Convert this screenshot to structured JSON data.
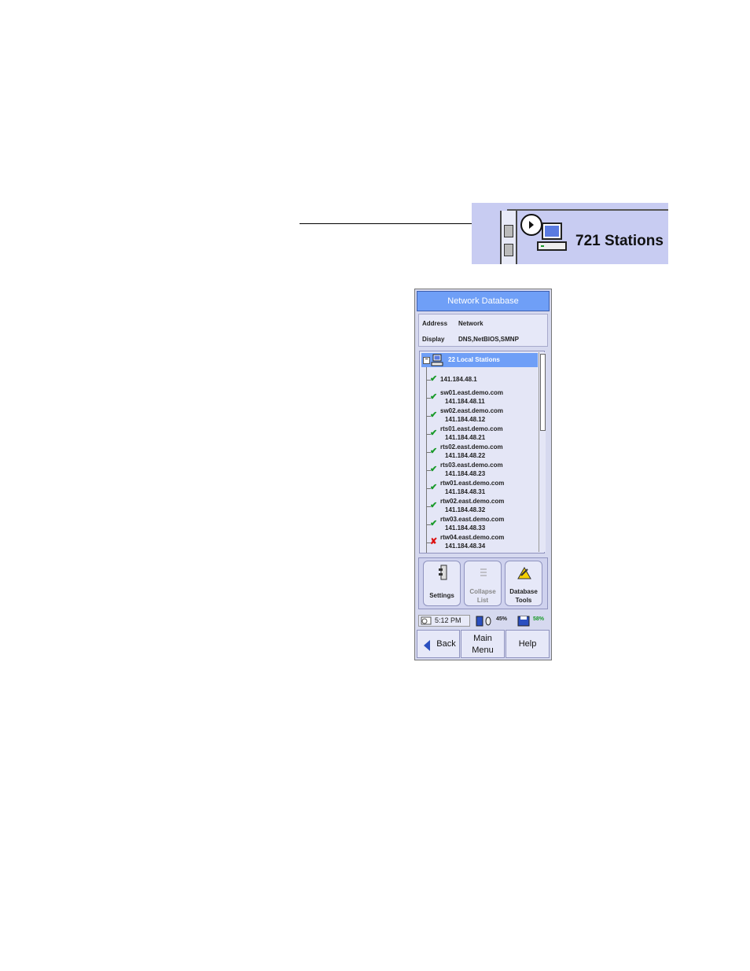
{
  "zoom": {
    "label": "721 Stations"
  },
  "window": {
    "title": "Network Database",
    "info": [
      {
        "label": "Address",
        "value": "Network"
      },
      {
        "label": "Display",
        "value": "DNS,NetBIOS,SMNP"
      }
    ]
  },
  "tree": {
    "root_label": "22 Local Stations",
    "stations": [
      {
        "name": "141.184.48.1",
        "ip": "",
        "status": "ok"
      },
      {
        "name": "sw01.east.demo.com",
        "ip": "141.184.48.11",
        "status": "ok"
      },
      {
        "name": "sw02.east.demo.com",
        "ip": "141.184.48.12",
        "status": "ok"
      },
      {
        "name": "rts01.east.demo.com",
        "ip": "141.184.48.21",
        "status": "ok"
      },
      {
        "name": "rts02.east.demo.com",
        "ip": "141.184.48.22",
        "status": "ok"
      },
      {
        "name": "rts03.east.demo.com",
        "ip": "141.184.48.23",
        "status": "ok"
      },
      {
        "name": "rtw01.east.demo.com",
        "ip": "141.184.48.31",
        "status": "ok"
      },
      {
        "name": "rtw02.east.demo.com",
        "ip": "141.184.48.32",
        "status": "ok"
      },
      {
        "name": "rtw03.east.demo.com",
        "ip": "141.184.48.33",
        "status": "ok"
      },
      {
        "name": "rtw04.east.demo.com",
        "ip": "141.184.48.34",
        "status": "error"
      }
    ]
  },
  "toolbar": {
    "settings_label": "Settings",
    "collapse_line1": "Collapse",
    "collapse_line2": "List",
    "dbtools_line1": "Database",
    "dbtools_line2": "Tools"
  },
  "status": {
    "time": "5:12 PM",
    "battery": "45%",
    "disk": "58%"
  },
  "nav": {
    "back": "Back",
    "main_line1": "Main",
    "main_line2": "Menu",
    "help": "Help"
  },
  "colors": {
    "title_blue": "#6f9ff7",
    "panel": "#d6d9ef",
    "ok_green": "#1a9a2a",
    "error_red": "#dd1111"
  }
}
